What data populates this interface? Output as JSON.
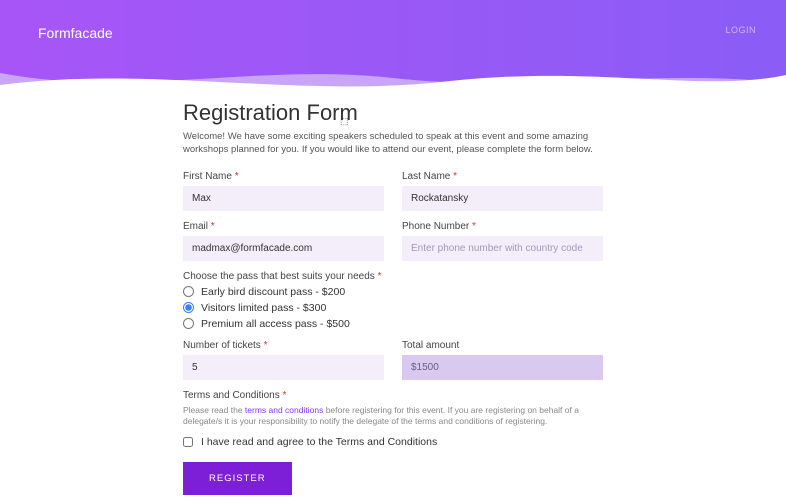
{
  "header": {
    "brand": "Formfacade",
    "login": "LOGIN"
  },
  "form": {
    "title": "Registration Form",
    "intro": "Welcome! We have some exciting speakers scheduled to speak at this event and some amazing workshops planned for you. If you would like to attend our event, please complete the form below.",
    "first_name_label": "First Name",
    "first_name_value": "Max",
    "last_name_label": "Last Name",
    "last_name_value": "Rockatansky",
    "email_label": "Email",
    "email_value": "madmax@formfacade.com",
    "phone_label": "Phone Number",
    "phone_placeholder": "Enter phone number with country code",
    "phone_value": "",
    "pass_label": "Choose the pass that best suits your needs",
    "pass_options": [
      {
        "label": "Early bird discount pass - $200",
        "checked": false
      },
      {
        "label": "Visitors limited pass - $300",
        "checked": true
      },
      {
        "label": "Premium all access pass - $500",
        "checked": false
      }
    ],
    "tickets_label": "Number of tickets",
    "tickets_value": "5",
    "total_label": "Total amount",
    "total_value": "$1500",
    "terms_heading": "Terms and Conditions",
    "terms_prefix": "Please read the ",
    "terms_link": "terms and conditions",
    "terms_suffix": " before registering for this event. If you are registering on behalf of a delegate/s it is your responsibility to notify the delegate of the terms and conditions of registering.",
    "checkbox_label": "I have read and agree to the Terms and Conditions",
    "register_button": "REGISTER"
  }
}
